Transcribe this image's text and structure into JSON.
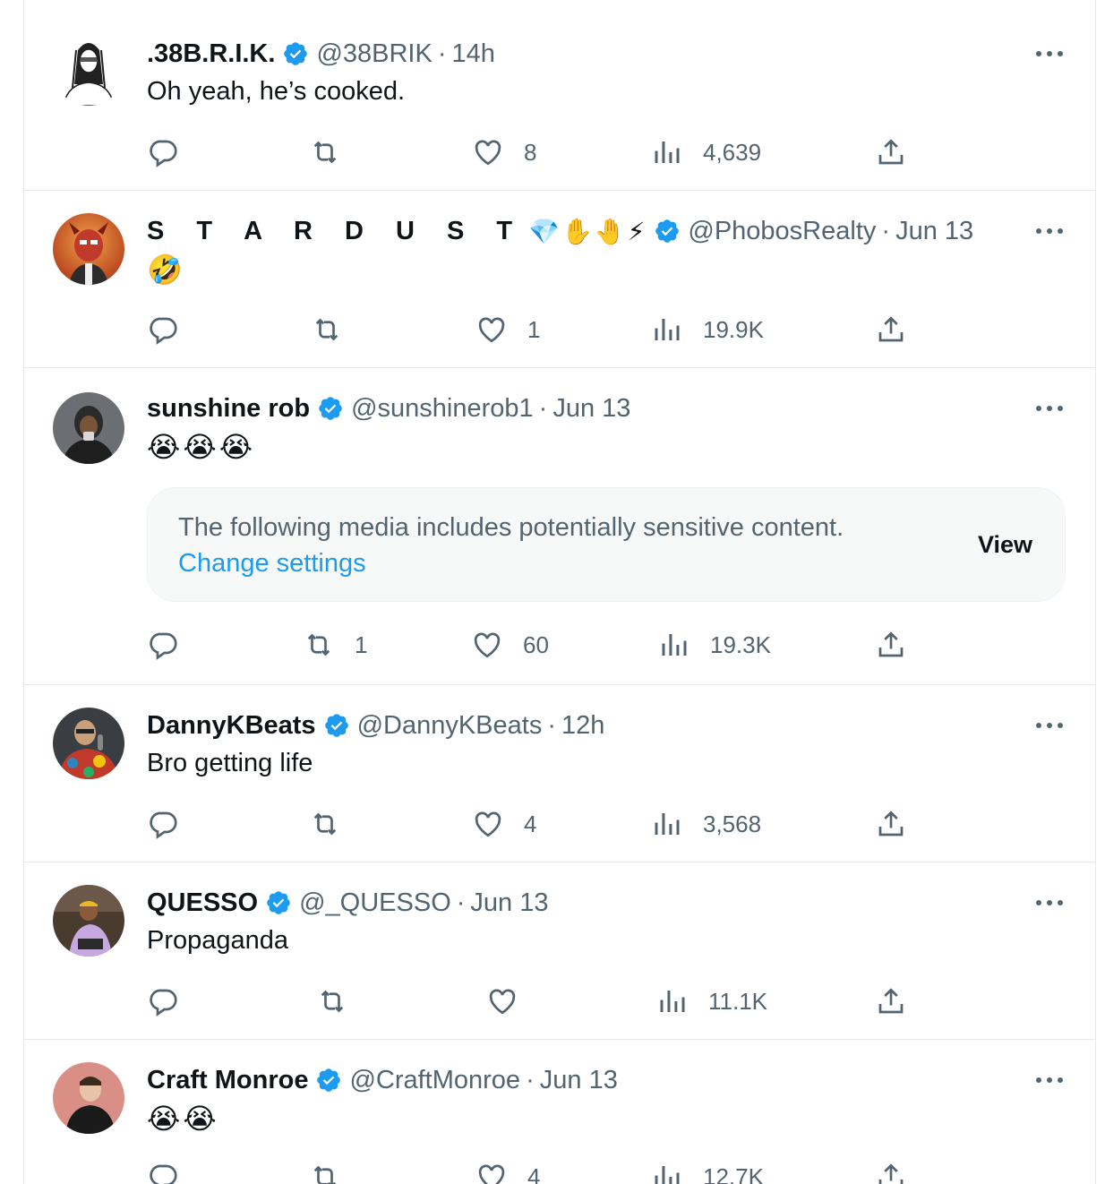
{
  "tweets": [
    {
      "display_name": ".38B.R.I.K.",
      "name_emoji": "",
      "verified": true,
      "handle": "@38BRIK",
      "separator": "·",
      "time": "14h",
      "text": "Oh yeah, he’s cooked.",
      "emoji_text": "",
      "replies": "",
      "reposts": "",
      "likes": "8",
      "views": "4,639",
      "avatar_icon": "sketch-portrait-avatar"
    },
    {
      "display_name": "S T A R D U S T",
      "name_emoji": "💎✋🤚⚡",
      "verified": true,
      "handle": "@PhobosRealty",
      "separator": "·",
      "time": "Jun 13",
      "text": "",
      "emoji_text": "🤣",
      "replies": "",
      "reposts": "",
      "likes": "1",
      "views": "19.9K",
      "avatar_icon": "cartoon-character-avatar"
    },
    {
      "display_name": "sunshine rob",
      "name_emoji": "",
      "verified": true,
      "handle": "@sunshinerob1",
      "separator": "·",
      "time": "Jun 13",
      "text": "",
      "emoji_text": "😭😭😭",
      "sensitive_notice": {
        "message": "The following media includes potentially sensitive content.",
        "link": "Change settings",
        "action": "View"
      },
      "replies": "",
      "reposts": "1",
      "likes": "60",
      "views": "19.3K",
      "avatar_icon": "photo-avatar"
    },
    {
      "display_name": "DannyKBeats",
      "name_emoji": "",
      "verified": true,
      "handle": "@DannyKBeats",
      "separator": "·",
      "time": "12h",
      "text": "Bro getting life",
      "emoji_text": "",
      "replies": "",
      "reposts": "",
      "likes": "4",
      "views": "3,568",
      "avatar_icon": "photo-avatar"
    },
    {
      "display_name": "QUESSO",
      "name_emoji": "",
      "verified": true,
      "handle": "@_QUESSO",
      "separator": "·",
      "time": "Jun 13",
      "text": "Propaganda",
      "emoji_text": "",
      "replies": "",
      "reposts": "",
      "likes": "",
      "views": "11.1K",
      "avatar_icon": "photo-avatar"
    },
    {
      "display_name": "Craft Monroe",
      "name_emoji": "",
      "verified": true,
      "handle": "@CraftMonroe",
      "separator": "·",
      "time": "Jun 13",
      "text": "",
      "emoji_text": "😭😭",
      "replies": "",
      "reposts": "",
      "likes": "4",
      "views": "12.7K",
      "avatar_icon": "photo-avatar"
    }
  ],
  "colors": {
    "verified_badge": "#1d9bf0",
    "secondary_text": "#536471",
    "link": "#1d9bf0",
    "divider": "#e7e9ea"
  }
}
